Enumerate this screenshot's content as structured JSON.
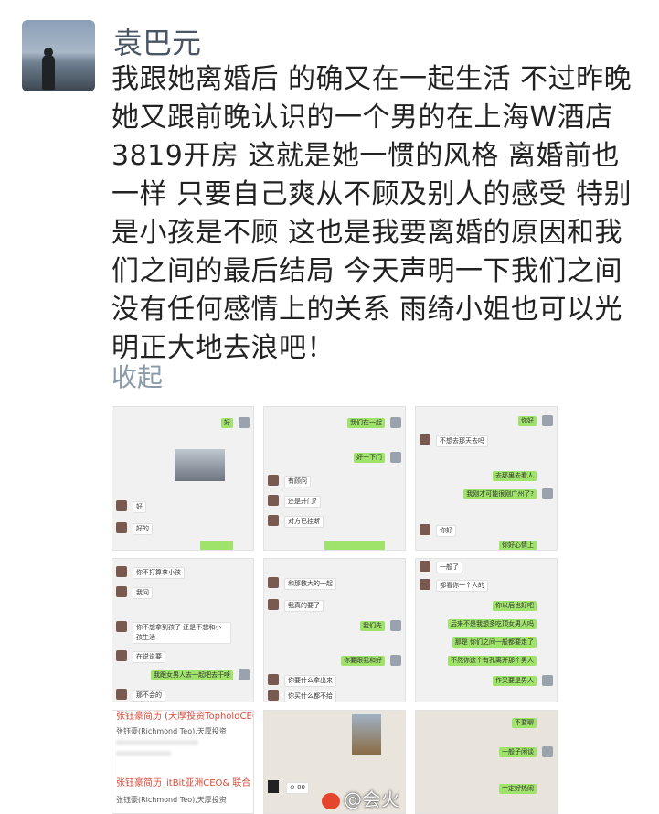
{
  "post": {
    "username": "袁巴元",
    "text": "我跟她离婚后 的确又在一起生活 不过昨晚她又跟前晚认识的一个男的在上海W酒店3819开房 这就是她一惯的风格 离婚前也一样 只要自己爽从不顾及别人的感受 特别是小孩是不顾 这也是我要离婚的原因和我们之间的最后结局 今天声明一下我们之间没有任何感情上的关系 雨绮小姐也可以光明正大地去浪吧！",
    "collapse_label": "收起"
  },
  "images": {
    "shot1": {
      "bubbles": [
        "好",
        "好",
        "好的"
      ]
    },
    "shot2": {
      "bubbles": [
        "我们在一起",
        "好一下门",
        "有顾问",
        "还是开门?",
        "对方已挂断"
      ]
    },
    "shot3": {
      "bubbles": [
        "你好",
        "不想去那天去吗",
        "去那里去看人",
        "我刚才可能很刚广州了?",
        "你好",
        "你好心情上"
      ]
    },
    "shot4": {
      "bubbles": [
        "你不打算拿小孩",
        "我问",
        "你不想拿到孩子 还是不想和小孩生活",
        "在说说要",
        "我跟女男人去一起吧去干啥",
        "那不会的"
      ]
    },
    "shot5": {
      "bubbles": [
        "和那教大的一起",
        "我真的要了",
        "我们先",
        "你要跟我和好",
        "你要什么拿出来",
        "你买什么都不给"
      ]
    },
    "shot6": {
      "bubbles": [
        "一般了",
        "都看你一个人的",
        "你以后也好吧",
        "后来不是我想多吃顶女男人吗",
        "那是 你们之间一般都要走了",
        "不然你这个有孔离开那个男人",
        "作又要是男人"
      ]
    },
    "shot7": {
      "name": "张钰豪简历 (天厚投资TopholdCEO) 权",
      "sub": "张钰豪(Richmond Teo),天厚投资"
    },
    "shot8": {
      "caption": "⊙ 00"
    },
    "shot9": {
      "bubbles": [
        "不要聊",
        "一般子闲谈",
        "一定好热闹"
      ]
    },
    "shot10": {
      "name": "张钰豪简历_itBit亚洲CEO& 联合",
      "sub": "张钰豪(Richmond Teo),天厚投资"
    }
  },
  "watermark": {
    "text": "@会火"
  }
}
